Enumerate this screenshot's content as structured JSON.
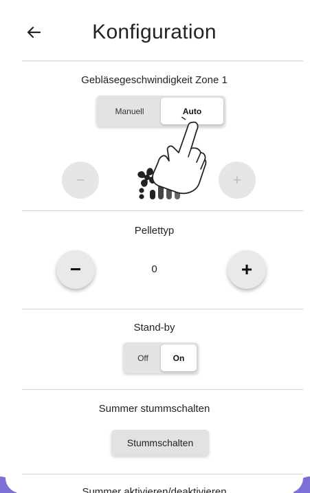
{
  "header": {
    "title": "Konfiguration",
    "back_icon": "arrow-left-icon"
  },
  "fan_zone": {
    "label": "Gebläsegeschwindigkeit Zone 1",
    "mode_options": [
      "Manuell",
      "Auto"
    ],
    "selected": "Auto",
    "minus_icon": "minus-icon",
    "plus_icon": "plus-icon",
    "fan_icon": "fan-speed-icon",
    "controls_disabled": true
  },
  "pellet": {
    "label": "Pellettyp",
    "value": "0",
    "minus_icon": "minus-icon",
    "plus_icon": "plus-icon"
  },
  "standby": {
    "label": "Stand-by",
    "options": [
      "Off",
      "On"
    ],
    "selected": "On"
  },
  "mute": {
    "label": "Summer stummschalten",
    "button_label": "Stummschalten"
  },
  "buzzer": {
    "label": "Summer aktivieren/deaktivieren"
  },
  "overlay": {
    "icon": "tap-hand-icon"
  },
  "colors": {
    "accent_corner": "#7c6fd6",
    "divider": "#cfcfcf",
    "button_bg": "#e2e2e2"
  }
}
